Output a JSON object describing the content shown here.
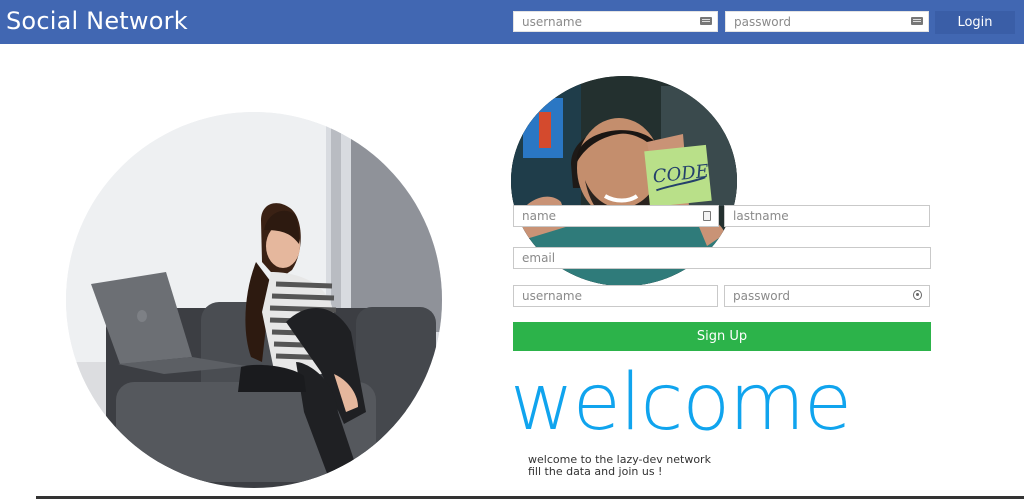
{
  "header": {
    "brand": "Social Network",
    "username_placeholder": "username",
    "password_placeholder": "password",
    "login_label": "Login",
    "bar_color": "#4167b2",
    "login_color": "#3a5ea7"
  },
  "images": {
    "left_photo": "woman with laptop on sofa",
    "right_photo": "man holding CODE sticky note",
    "sticky_note_text": "CODE"
  },
  "signup": {
    "name_placeholder": "name",
    "lastname_placeholder": "lastname",
    "email_placeholder": "email",
    "username_placeholder": "username",
    "password_placeholder": "password",
    "button_label": "Sign Up",
    "button_color": "#2cb34a"
  },
  "welcome": {
    "title": "welcome",
    "line1": "welcome to the lazy-dev network",
    "line2": "fill the data and join us !",
    "title_color": "#10a4ee"
  }
}
